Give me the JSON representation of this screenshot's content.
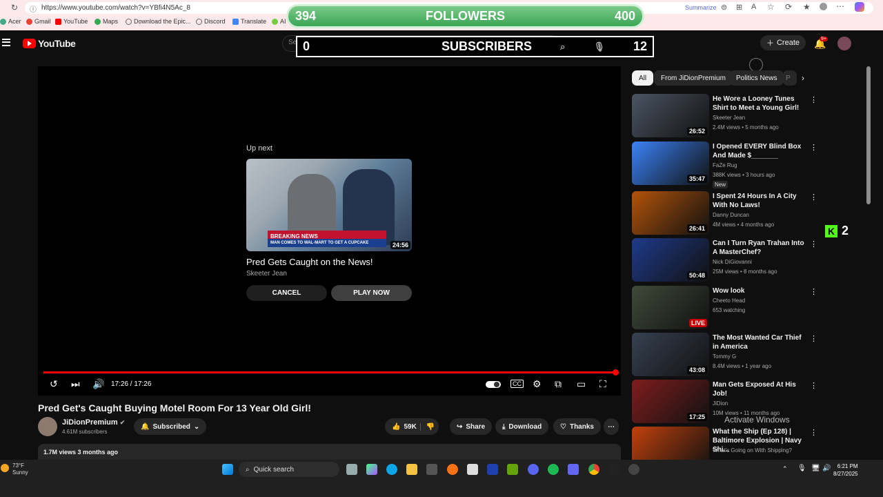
{
  "browser": {
    "url": "https://www.youtube.com/watch?v=YBfi4N5Ac_8",
    "summarize_label": "Summarize",
    "bookmarks": [
      {
        "label": "Acer",
        "color": "#4a8"
      },
      {
        "label": "Gmail",
        "color": "#ea4335"
      },
      {
        "label": "YouTube",
        "color": "#f00"
      },
      {
        "label": "Maps",
        "color": "#34a853"
      },
      {
        "label": "Download the Epic...",
        "color": "#666"
      },
      {
        "label": "Discord",
        "color": "#666"
      },
      {
        "label": "Translate",
        "color": "#4285f4"
      },
      {
        "label": "AI",
        "color": "#7c4"
      }
    ]
  },
  "overlay": {
    "followers_left": "394",
    "followers_label": "FOLLOWERS",
    "followers_right": "400",
    "subs_left": "0",
    "subs_label": "SUBSCRIBERS",
    "subs_right": "12",
    "kick_count": "2",
    "search_placeholder": "Search"
  },
  "header": {
    "logo_text": "YouTube",
    "create_label": "Create",
    "notif_badge": "9+"
  },
  "player": {
    "up_next_label": "Up next",
    "next_title": "Pred Gets Caught on the News!",
    "next_channel": "Skeeter Jean",
    "next_duration": "24:56",
    "breaking_text": "BREAKING NEWS",
    "breaking_sub": "MAN COMES TO WAL-MART TO GET A CUPCAKE",
    "cancel_label": "CANCEL",
    "play_label": "PLAY NOW",
    "time": "17:26 / 17:26",
    "progress": 1.0
  },
  "video": {
    "title": "Pred Get's Caught Buying Motel Room For 13 Year Old Girl!",
    "channel": "JiDionPremium",
    "subscribers": "4.61M subscribers",
    "subscribed_label": "Subscribed",
    "likes": "59K",
    "share_label": "Share",
    "download_label": "Download",
    "thanks_label": "Thanks",
    "views_date": "1.7M views  3 months ago"
  },
  "sidebar": {
    "chips": [
      "All",
      "From JiDionPremium",
      "Politics News",
      "P"
    ],
    "videos": [
      {
        "title": "He Wore a Looney Tunes Shirt to Meet a Young Girl!",
        "channel": "Skeeter Jean",
        "meta": "2.4M views • 5 months ago",
        "duration": "26:52",
        "color": "#4b5563"
      },
      {
        "title": "I Opened EVERY Blind Box And Made $_______",
        "channel": "FaZe Rug",
        "meta": "388K views • 3 hours ago",
        "duration": "35:47",
        "badge": "New",
        "color": "#3b82f6"
      },
      {
        "title": "I Spent 24 Hours In A City With No Laws!",
        "channel": "Danny Duncan",
        "meta": "4M views • 4 months ago",
        "duration": "26:41",
        "color": "#b45309"
      },
      {
        "title": "Can I Turn Ryan Trahan Into A MasterChef?",
        "channel": "Nick DiGiovanni",
        "meta": "25M views • 8 months ago",
        "duration": "50:48",
        "color": "#1e3a8a"
      },
      {
        "title": "Wow look",
        "channel": "Cheeto Head",
        "meta": "653 watching",
        "duration": "LIVE",
        "color": "#3f4a3a"
      },
      {
        "title": "The Most Wanted Car Thief in America",
        "channel": "Tommy G",
        "meta": "8.4M views • 1 year ago",
        "duration": "43:08",
        "color": "#374151"
      },
      {
        "title": "Man Gets Exposed At His Job!",
        "channel": "JiDion",
        "meta": "10M views • 11 months ago",
        "duration": "17:25",
        "color": "#7f1d1d"
      },
      {
        "title": "What the Ship (Ep 128) | Baltimore Explosion | Navy Shi...",
        "channel": "What's Going on With Shipping?",
        "meta": "",
        "duration": "",
        "color": "#c2410c"
      }
    ]
  },
  "os": {
    "activate_text": "Activate Windows",
    "temp": "73°F",
    "weather": "Sunny",
    "search_label": "Quick search",
    "time": "6:21 PM",
    "date": "8/27/2025"
  }
}
